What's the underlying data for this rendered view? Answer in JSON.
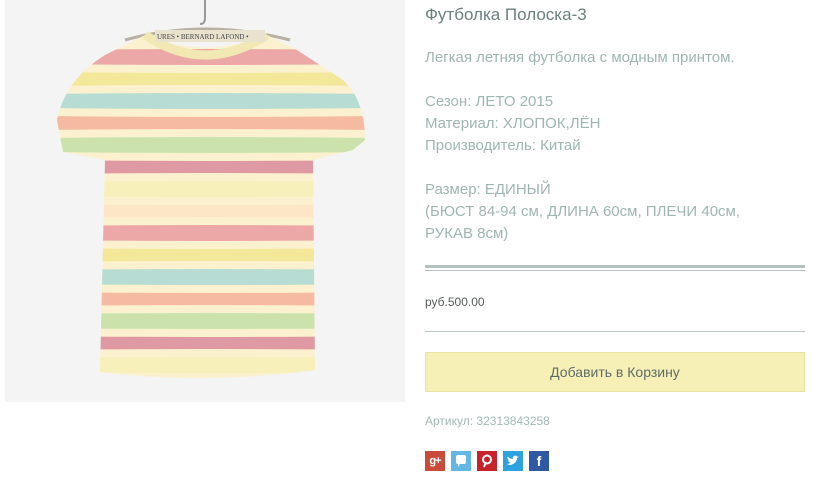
{
  "product": {
    "title": "Футболка Полоска-3",
    "tagline": "Легкая летняя футболка с модным принтом.",
    "season": "Сезон: ЛЕТО 2015",
    "material": "Материал: ХЛОПОК,ЛЁН",
    "maker": "Производитель: Китай",
    "size": "Размер: ЕДИНЫЙ",
    "size_details_1": "(БЮСТ 84-94 см, ДЛИНА 60см, ПЛЕЧИ 40см,",
    "size_details_2": "РУКАВ 8см)",
    "price": "руб.500.00",
    "add_to_cart": "Добавить в Корзину",
    "sku_label": "Артикул:",
    "sku_value": "32313843258",
    "tag_text": "URES • BERNARD LAFOND •"
  },
  "image": {
    "stripe_colors": [
      "#e99ba0",
      "#f1e58f",
      "#a9d8d4",
      "#f3b09a",
      "#c3dfa6",
      "#d98a9a",
      "#f7f0b6",
      "#fbe4c4"
    ]
  },
  "share": [
    {
      "name": "google-plus",
      "glyph": "g+"
    },
    {
      "name": "viber",
      "glyph": ""
    },
    {
      "name": "pinterest",
      "glyph": "P"
    },
    {
      "name": "twitter",
      "glyph": ""
    },
    {
      "name": "facebook",
      "glyph": "f"
    }
  ],
  "colors": {
    "title": "#6b7f7c",
    "spec_text": "#9fb5b2",
    "button_bg": "#f7f0b6",
    "rule": "#b3c3c0"
  }
}
